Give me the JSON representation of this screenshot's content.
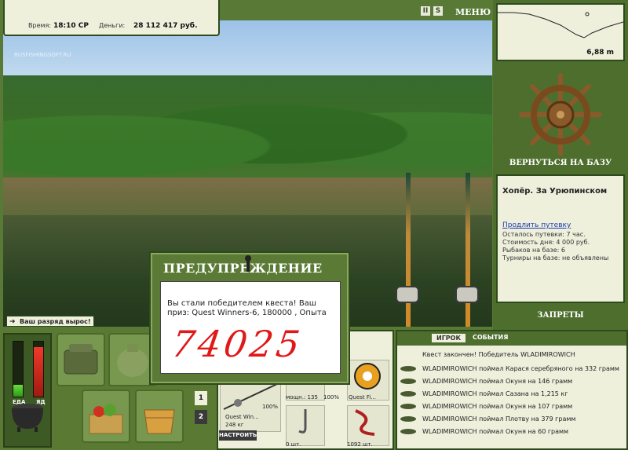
{
  "infobar": {
    "time_label": "Время:",
    "time_value": "18:10 СР",
    "money_label": "Деньги:",
    "money_value": "28 112 417 руб."
  },
  "menu": {
    "label": "МЕНЮ",
    "pause": "II",
    "sound": "S"
  },
  "scene": {
    "logo": "RUSFISHINGSOFT.RU"
  },
  "depth": {
    "value": "6,88 m"
  },
  "right_panel": {
    "return_label": "ВЕРНУТЬСЯ НА БАЗУ",
    "base_title": "Хопёр. За Урюпинском",
    "extend_link": "Продлить путевку",
    "lines": [
      "Осталось путевки: 7 час.",
      "Стоимость дня: 4 000 руб.",
      "Рыбаков на базе: 6",
      "Турниры на базе: не объявлены"
    ],
    "bans_label": "ЗАПРЕТЫ"
  },
  "rank": {
    "text": "Ваш разряд вырос!"
  },
  "gauges": {
    "food_label": "ЕДА",
    "poison_label": "ЯД",
    "food_level": 0.22,
    "poison_level": 0.9
  },
  "slots": {
    "page1": "1",
    "page2": "2"
  },
  "gear": {
    "rod_name": "Quest Win...",
    "rod_weight": "248 кг",
    "tune_label": "НАСТРОИТЬ",
    "pct1": "100%",
    "pct2": "100%",
    "power": "мощн.: 135",
    "line_name": "Quest Fi...",
    "hook_count": "0 шт.",
    "bait_count": "1092 шт."
  },
  "events": {
    "tab_player": "ИГРОК",
    "tab_events": "СОБЫТИЯ",
    "items": [
      "Квест закончен! Победитель WLADIMIROWICH",
      "WLADIMIROWICH поймал Карася серебряного на 332 грамм",
      "WLADIMIROWICH поймал Окуня на 146 грамм",
      "WLADIMIROWICH поймал Сазана на 1,215 кг",
      "WLADIMIROWICH поймал Окуня на 107 грамм",
      "WLADIMIROWICH поймал Плотву на 379 грамм",
      "WLADIMIROWICH поймал Окуня на 60 грамм"
    ]
  },
  "dialog": {
    "title": "ПРЕДУПРЕЖДЕНИЕ",
    "message": "Вы стали победителем квеста! Ваш приз: Quest Winners-6, 180000 , Опыта",
    "amount": "74025"
  },
  "colors": {
    "panel": "#587a36",
    "paper": "#eef0dc",
    "warning_red": "#e01818",
    "link": "#1a3ab0"
  }
}
